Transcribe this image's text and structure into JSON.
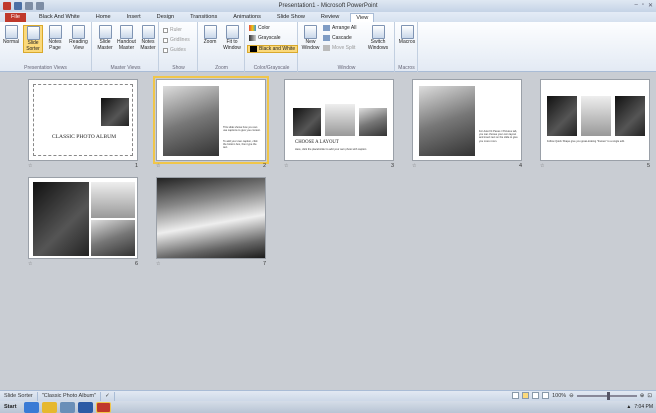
{
  "titlebar": {
    "title": "Presentation1 - Microsoft PowerPoint",
    "qat_icons": [
      "save-icon",
      "undo-icon",
      "redo-icon"
    ]
  },
  "tabs": [
    {
      "label": "File",
      "key": "file"
    },
    {
      "label": "Black And White",
      "key": "bw"
    },
    {
      "label": "Home",
      "key": "home"
    },
    {
      "label": "Insert",
      "key": "insert"
    },
    {
      "label": "Design",
      "key": "design"
    },
    {
      "label": "Transitions",
      "key": "transitions"
    },
    {
      "label": "Animations",
      "key": "animations"
    },
    {
      "label": "Slide Show",
      "key": "slideshow"
    },
    {
      "label": "Review",
      "key": "review"
    },
    {
      "label": "View",
      "key": "view"
    }
  ],
  "ribbon": {
    "presentation_views": {
      "label": "Presentation Views",
      "normal": "Normal",
      "slide_sorter": "Slide Sorter",
      "notes_page": "Notes Page",
      "reading_view": "Reading View"
    },
    "master_views": {
      "label": "Master Views",
      "slide_master": "Slide Master",
      "handout_master": "Handout Master",
      "notes_master": "Notes Master"
    },
    "show": {
      "label": "Show",
      "ruler": "Ruler",
      "gridlines": "Gridlines",
      "guides": "Guides"
    },
    "zoom": {
      "label": "Zoom",
      "zoom": "Zoom",
      "fit": "Fit to Window"
    },
    "color": {
      "label": "Color/Grayscale",
      "color": "Color",
      "grayscale": "Grayscale",
      "bw": "Black and White"
    },
    "window": {
      "label": "Window",
      "new": "New Window",
      "arrange": "Arrange All",
      "cascade": "Cascade",
      "move": "Move Split",
      "switch": "Switch Windows"
    },
    "macros": {
      "label": "Macros",
      "macros": "Macros"
    }
  },
  "slides": {
    "s1": {
      "num": "1",
      "title": "CLASSIC PHOTO ALBUM"
    },
    "s2": {
      "num": "2",
      "text1": "This slide shows how you can use captions to give you context.",
      "text2": "To add your own caption, click the bottom box, then type the text."
    },
    "s3": {
      "num": "3",
      "title": "CHOOSE A LAYOUT",
      "text": "Here, click the placeholder to add your own photo with caption"
    },
    "s4": {
      "num": "4",
      "text": "For Auto Fit Panes / Pictures tab, you can choose your own layout and insert text on the slide to give you more room."
    },
    "s5": {
      "num": "5",
      "text": "Follow Quick Shape give you great-looking \"frames\" to a single edit."
    },
    "s6": {
      "num": "6"
    },
    "s7": {
      "num": "7"
    }
  },
  "statusbar": {
    "view": "Slide Sorter",
    "theme": "\"Classic Photo Album\"",
    "zoom": "100%"
  },
  "taskbar": {
    "start": "Start",
    "time": "7:04 PM"
  }
}
